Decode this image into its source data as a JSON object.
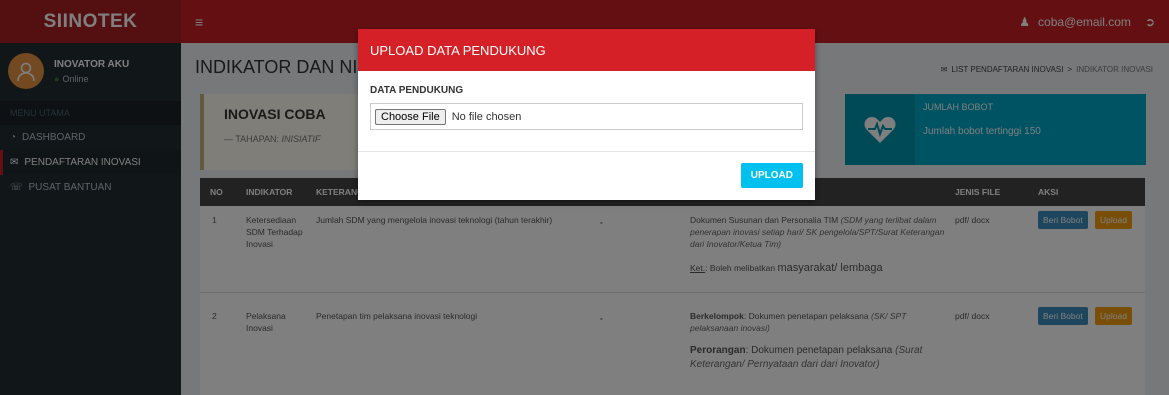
{
  "app": {
    "brand": "SIINOTEK",
    "user_email": "coba@email.com"
  },
  "sidebar": {
    "user_name": "INOVATOR AKU",
    "user_status": "Online",
    "menu_header": "MENU UTAMA",
    "items": [
      {
        "label": "DASHBOARD",
        "icon": "dashboard-icon"
      },
      {
        "label": "PENDAFTARAN INOVASI",
        "icon": "envelope-icon"
      },
      {
        "label": "PUSAT BANTUAN",
        "icon": "whatsapp-icon"
      }
    ]
  },
  "main": {
    "title": "INDIKATOR DAN NILAI BOBOT",
    "breadcrumb": [
      "LIST PENDAFTARAN INOVASI",
      "INDIKATOR INOVASI"
    ],
    "info": {
      "title": "INOVASI COBA",
      "stage_prefix": "— TAHAPAN:",
      "stage": "INISIATIF"
    },
    "stat": {
      "label": "JUMLAH BOBOT",
      "value": "Jumlah bobot tertinggi 150"
    },
    "table": {
      "headers": [
        "NO",
        "INDIKATOR",
        "KETERANGAN",
        "",
        "JENIS FILE",
        "AKSI"
      ],
      "rows": [
        {
          "no": "1",
          "indikator": "Ketersediaan SDM Terhadap Inovasi",
          "keterangan": "Jumlah SDM yang mengelola inovasi teknologi (tahun terakhir)",
          "nilai": "-",
          "data_prefix": "Dokumen Susunan dan Personalia TIM",
          "data_italic": "(SDM yang terlibat dalam penerapan inovasi setiap hari/ SK pengelola/SPT/Surat Keterangan dari Inovator/Ketua Tim)",
          "note_label": "Ket.",
          "note": ": Boleh melibatkan",
          "note_big": "masyarakat/ lembaga",
          "jenis": "pdf/ docx",
          "btn_bobot": "Beri Bobot",
          "btn_upload": "Upload"
        },
        {
          "no": "2",
          "indikator": "Pelaksana Inovasi",
          "keterangan": "Penetapan tim pelaksana inovasi teknologi",
          "nilai": "-",
          "group1": "Berkelompok",
          "group1_text": ": Dokumen penetapan pelaksana",
          "group1_italic": "(SK/ SPT pelaksanaan inovasi)",
          "group2": "Perorangan",
          "group2_text": ": Dokumen penetapan pelaksana",
          "group2_italic": "(Surat Keterangan/ Pernyataan dari dari Inovator)",
          "jenis": "pdf/ docx",
          "btn_bobot": "Beri Bobot",
          "btn_upload": "Upload"
        }
      ]
    }
  },
  "modal": {
    "title": "UPLOAD DATA PENDUKUNG",
    "label": "DATA PENDUKUNG",
    "choose_label": "Choose File",
    "file_status": "No file chosen",
    "submit": "UPLOAD"
  }
}
